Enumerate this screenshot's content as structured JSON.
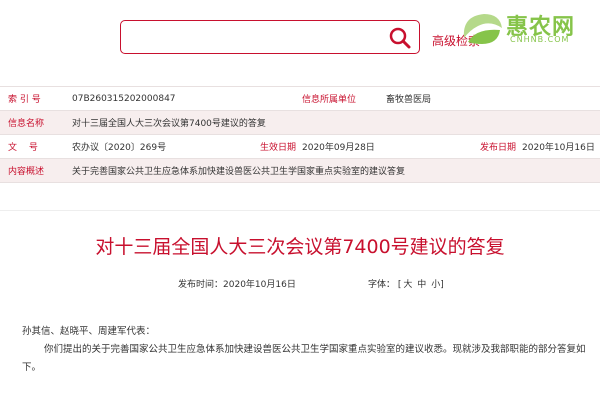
{
  "header": {
    "search": {
      "value": "",
      "placeholder": ""
    },
    "advanced_search_label": "高级检索",
    "brand": {
      "name": "惠农网",
      "subtitle": "CNHNB.COM",
      "color": "#86c44a"
    },
    "accent": "#c8102e"
  },
  "info": {
    "rows": [
      {
        "label1": "索 引 号",
        "value1": "07B260315202000847",
        "label2": "信息所属单位",
        "value2": "畜牧兽医局"
      },
      {
        "label1": "信息名称",
        "value1": "对十三届全国人大三次会议第7400号建议的答复"
      },
      {
        "label1": "文　 号",
        "value1": "农办议〔2020〕269号",
        "label2": "生效日期",
        "value2": "2020年09月28日",
        "label3": "发布日期",
        "value3": "2020年10月16日"
      },
      {
        "label1": "内容概述",
        "value1": "关于完善国家公共卫生应急体系加快建设兽医公共卫生学国家重点实验室的建议答复"
      }
    ]
  },
  "article": {
    "title": "对十三届全国人大三次会议第7400号建议的答复",
    "publish_label": "发布时间：",
    "publish_date": "2020年10月16日",
    "font_label": "字体：",
    "font_sizes": {
      "open": "[",
      "large": "大",
      "medium": "中",
      "small": "小",
      "close": "]"
    },
    "salutation": "孙其信、赵晓平、周建军代表：",
    "paragraph": "你们提出的关于完善国家公共卫生应急体系加快建设兽医公共卫生学国家重点实验室的建议收悉。现就涉及我部职能的部分答复如下。"
  }
}
